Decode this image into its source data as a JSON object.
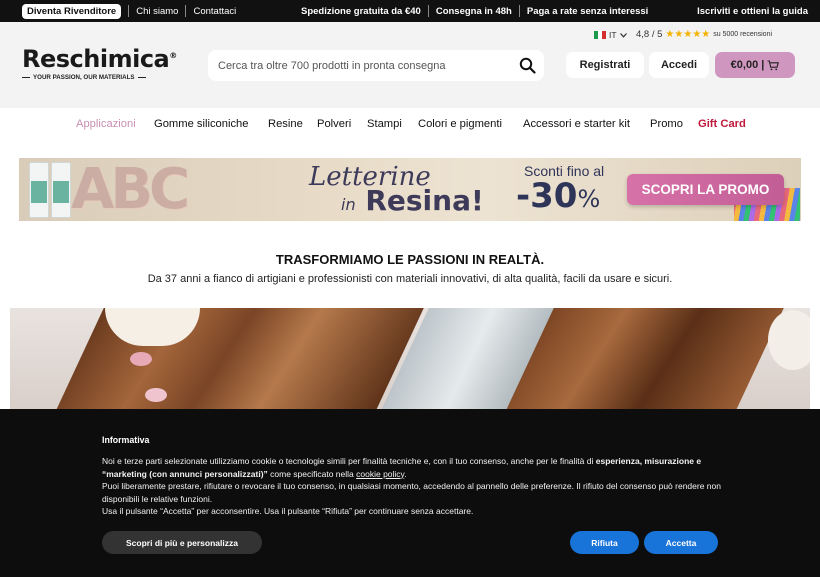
{
  "topbar": {
    "reseller": "Diventa Rivenditore",
    "about": "Chi siamo",
    "contacts": "Contattaci",
    "shipping": "Spedizione gratuita da €40",
    "delivery": "Consegna in 48h",
    "installments": "Paga a rate senza interessi",
    "signup": "Iscriviti e ottieni la guida"
  },
  "header": {
    "logo_main": "Reschimica",
    "logo_reg": "®",
    "logo_tagline": "YOUR PASSION, OUR MATERIALS",
    "search_placeholder": "Cerca tra oltre 700 prodotti in pronta consegna",
    "language": "IT",
    "rating": "4,8 / 5",
    "stars": "★★★★★",
    "reviews": "su 5000 recensioni",
    "register": "Registrati",
    "login": "Accedi",
    "cart_total": "€0,00 |",
    "icons": [
      "search-icon",
      "cart-icon",
      "chevron-down-icon",
      "italy-flag-icon"
    ]
  },
  "nav": {
    "items": [
      "Applicazioni",
      "Gomme siliconiche",
      "Resine",
      "Polveri",
      "Stampi",
      "Colori e pigmenti",
      "Accessori e starter kit",
      "Promo",
      "Gift Card"
    ]
  },
  "banner": {
    "letters": "ABC",
    "headline_1": "Letterine",
    "headline_2_prefix": "in",
    "headline_2": "Resina!",
    "discount_label": "Sconti fino al",
    "discount_value": "-30",
    "discount_unit": "%",
    "cta": "SCOPRI LA PROMO"
  },
  "tagline": {
    "title": "TRASFORMIAMO LE PASSIONI IN REALTÀ.",
    "subtitle": "Da 37 anni a fianco di artigiani e professionisti con materiali innovativi, di alta qualità, facili da usare e sicuri."
  },
  "cookie": {
    "title": "Informativa",
    "p1_a": "Noi e terze parti selezionate utilizziamo cookie o tecnologie simili per finalità tecniche e, con il tuo consenso, anche per le finalità di ",
    "p1_b": "esperienza, misurazione e “marketing (con annunci personalizzati)”",
    "p1_c": " come specificato nella ",
    "p1_link": "cookie policy",
    "p1_d": ".",
    "p2": "Puoi liberamente prestare, rifiutare o revocare il tuo consenso, in qualsiasi momento, accedendo al pannello delle preferenze. Il rifiuto del consenso può rendere non disponibili le relative funzioni.",
    "p3": "Usa il pulsante “Accetta” per acconsentire. Usa il pulsante “Rifiuta” per continuare senza accettare.",
    "more_button": "Scopri di più e personalizza",
    "reject_button": "Rifiuta",
    "accept_button": "Accetta"
  },
  "colors": {
    "accent_pink": "#cf97bf",
    "gift_red": "#c0183a",
    "cookie_blue": "#1874d8"
  }
}
